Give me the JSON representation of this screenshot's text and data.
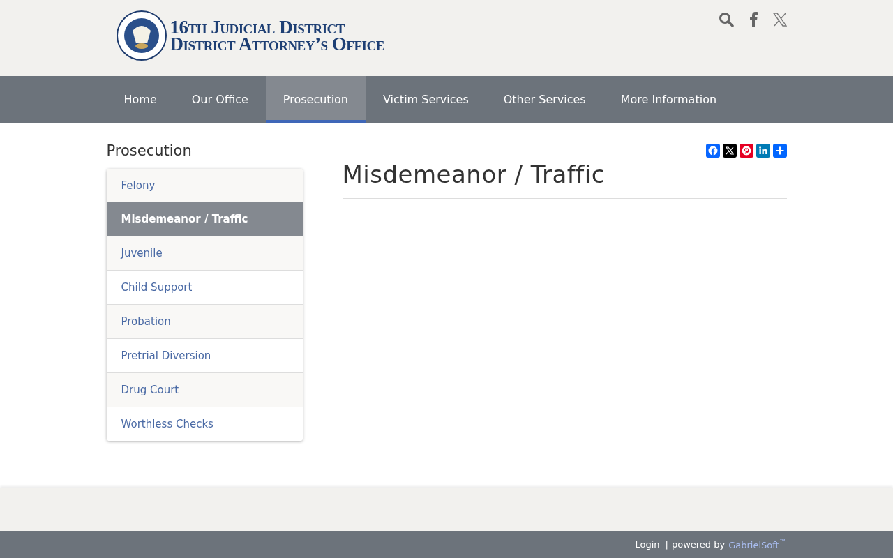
{
  "header": {
    "logo_line_1": "16th Judicial District",
    "logo_line_2": "District Attorney’s Office"
  },
  "nav": [
    {
      "label": "Home",
      "selected": false
    },
    {
      "label": "Our Office",
      "selected": false
    },
    {
      "label": "Prosecution",
      "selected": true
    },
    {
      "label": "Victim Services",
      "selected": false
    },
    {
      "label": "Other Services",
      "selected": false
    },
    {
      "label": "More Information",
      "selected": false
    }
  ],
  "sidebar": {
    "title": "Prosecution",
    "items": [
      {
        "label": "Felony",
        "selected": false
      },
      {
        "label": "Misdemeanor / Traffic",
        "selected": true
      },
      {
        "label": "Juvenile",
        "selected": false
      },
      {
        "label": "Child Support",
        "selected": false
      },
      {
        "label": "Probation",
        "selected": false
      },
      {
        "label": "Pretrial Diversion",
        "selected": false
      },
      {
        "label": "Drug Court",
        "selected": false
      },
      {
        "label": "Worthless Checks",
        "selected": false
      }
    ]
  },
  "share": [
    {
      "kind": "facebook",
      "color": "#0866ff"
    },
    {
      "kind": "x",
      "color": "#000000"
    },
    {
      "kind": "pinterest",
      "color": "#e60023"
    },
    {
      "kind": "linkedin",
      "color": "#007bb5"
    },
    {
      "kind": "share",
      "color": "#0166ff"
    }
  ],
  "content": {
    "title": "Misdemeanor / Traffic"
  },
  "footer": {
    "login": "Login",
    "separator": "|",
    "powered": "powered by",
    "brand": "GabrielSoft$^{™}$"
  }
}
